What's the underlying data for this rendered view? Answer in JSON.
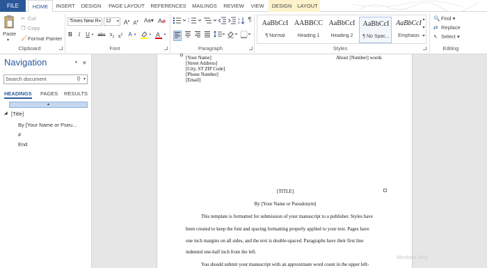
{
  "tabs": {
    "file": "FILE",
    "items": [
      "HOME",
      "INSERT",
      "DESIGN",
      "PAGE LAYOUT",
      "REFERENCES",
      "MAILINGS",
      "REVIEW",
      "VIEW",
      "DESIGN",
      "LAYOUT"
    ],
    "active": "HOME"
  },
  "ribbon": {
    "clipboard": {
      "paste": "Paste",
      "cut": "Cut",
      "copy": "Copy",
      "format_painter": "Format Painter",
      "label": "Clipboard"
    },
    "font": {
      "name": "Times New R",
      "size": "12",
      "label": "Font"
    },
    "paragraph": {
      "label": "Paragraph"
    },
    "styles": {
      "label": "Styles",
      "items": [
        {
          "preview": "AaBbCcI",
          "name": "¶ Normal"
        },
        {
          "preview": "AABBCC",
          "name": "Heading 1"
        },
        {
          "preview": "AaBbCcI",
          "name": "Heading 2"
        },
        {
          "preview": "AaBbCcI",
          "name": "¶ No Spac..."
        },
        {
          "preview": "AaBbCcI",
          "name": "Emphasis"
        }
      ]
    },
    "editing": {
      "find": "Find",
      "replace": "Replace",
      "select": "Select",
      "label": "Editing"
    }
  },
  "navigation": {
    "title": "Navigation",
    "search_placeholder": "Search document",
    "tabs": [
      "HEADINGS",
      "PAGES",
      "RESULTS"
    ],
    "items": [
      "[Title]",
      "By [Your Name or Pseu...",
      "#",
      "End"
    ]
  },
  "document": {
    "header_left": [
      "[Your Name]",
      "[Street Address]",
      "[City, ST  ZIP Code]",
      "[Phone Number]",
      "[Email]"
    ],
    "header_right": "About [Number] words",
    "title": "[TITLE]",
    "byline": "By [Your Name or Pseudonym]",
    "body": [
      "This template is formatted for submission of your manuscript to a publisher. Styles have",
      "been created to keep the font and spacing formatting properly applied to your text. Pages have",
      "one inch margins on all sides, and the text is double-spaced.  Paragraphs have their first line",
      "indented one-half inch from the left.",
      "You should submit your manuscript with an approximate word count in the upper left-"
    ]
  },
  "overlay": {
    "watermark": "Windows Snip"
  },
  "colors": {
    "accent": "#2b579a",
    "context_tab": "#fdf3cb"
  }
}
